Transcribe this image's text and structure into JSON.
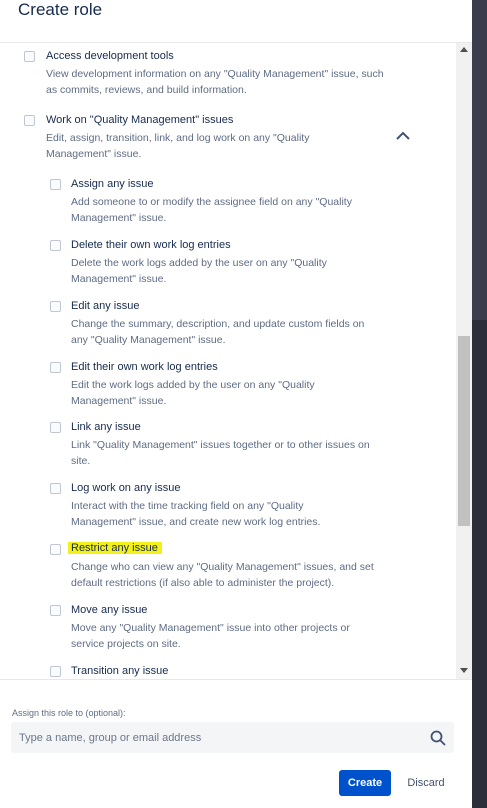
{
  "dialog": {
    "title": "Create role"
  },
  "permissions": {
    "access_dev_tools": {
      "label": "Access development tools",
      "desc_1": "View development information on any \"Quality Management\" issue, such",
      "desc_2": "as commits, reviews, and build information."
    },
    "work_on_issues": {
      "label": "Work on \"Quality Management\" issues",
      "desc_1": "Edit, assign, transition, link, and log work on any \"Quality",
      "desc_2": "Management\" issue.",
      "expanded": true,
      "children": [
        {
          "label": "Assign any issue",
          "desc_1": "Add someone to or modify the assignee field on any \"Quality",
          "desc_2": "Management\" issue."
        },
        {
          "label": "Delete their own work log entries",
          "desc_1": "Delete the work logs added by the user on any \"Quality",
          "desc_2": "Management\" issue."
        },
        {
          "label": "Edit any issue",
          "desc_1": "Change the summary, description, and update custom fields on",
          "desc_2": "any \"Quality Management\" issue."
        },
        {
          "label": "Edit their own work log entries",
          "desc_1": "Edit the work logs added by the user on any \"Quality",
          "desc_2": "Management\" issue."
        },
        {
          "label": "Link any issue",
          "desc_1": "Link \"Quality Management\" issues together or to other issues on",
          "desc_2": "site."
        },
        {
          "label": "Log work on any issue",
          "desc_1": "Interact with the time tracking field on any \"Quality",
          "desc_2": "Management\" issue, and create new work log entries."
        },
        {
          "label": "Restrict any issue",
          "desc_1": "Change who can view any \"Quality Management\" issues, and set",
          "desc_2": "default restrictions (if also able to administer the project).",
          "highlighted": true,
          "highlight_color": "#f4f11a"
        },
        {
          "label": "Move any issue",
          "desc_1": "Move any \"Quality Management\" issue into other projects or",
          "desc_2": "service projects on site."
        },
        {
          "label": "Transition any issue"
        }
      ]
    }
  },
  "assign": {
    "label": "Assign this role to (optional):",
    "placeholder": "Type a name, group or email address",
    "value": ""
  },
  "actions": {
    "create_label": "Create",
    "discard_label": "Discard"
  },
  "icons": {
    "collapse": "chevron-up-icon",
    "search": "search-icon"
  },
  "colors": {
    "primary": "#0052cc",
    "highlight": "#f4f11a",
    "text": "#172b4d",
    "subtext": "#5e6c84"
  }
}
